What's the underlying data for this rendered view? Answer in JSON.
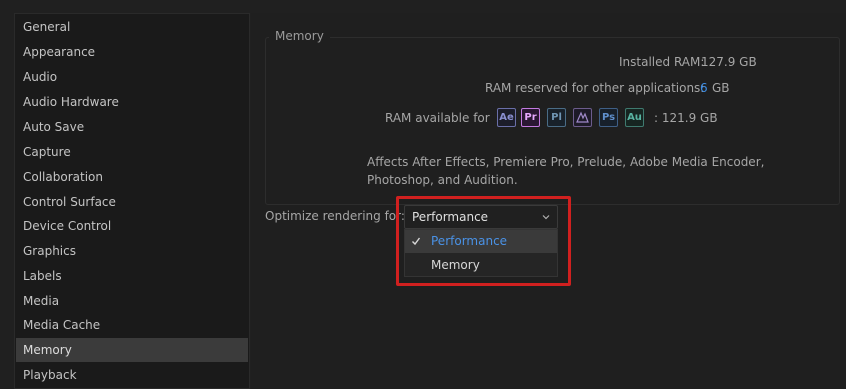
{
  "sidebar": {
    "items": [
      {
        "label": "General"
      },
      {
        "label": "Appearance"
      },
      {
        "label": "Audio"
      },
      {
        "label": "Audio Hardware"
      },
      {
        "label": "Auto Save"
      },
      {
        "label": "Capture"
      },
      {
        "label": "Collaboration"
      },
      {
        "label": "Control Surface"
      },
      {
        "label": "Device Control"
      },
      {
        "label": "Graphics"
      },
      {
        "label": "Labels"
      },
      {
        "label": "Media"
      },
      {
        "label": "Media Cache"
      },
      {
        "label": "Memory",
        "selected": true
      },
      {
        "label": "Playback"
      }
    ]
  },
  "memory": {
    "group_title": "Memory",
    "installed_ram_label": "Installed RAM:",
    "installed_ram_value": "127.9 GB",
    "reserved_label": "RAM reserved for other applications:",
    "reserved_value": "6",
    "reserved_unit": "GB",
    "available_label": "RAM available for",
    "available_value": ": 121.9 GB",
    "apps": [
      {
        "abbr": "Ae",
        "icon": "after-effects-icon"
      },
      {
        "abbr": "Pr",
        "icon": "premiere-pro-icon"
      },
      {
        "abbr": "Pl",
        "icon": "prelude-icon"
      },
      {
        "abbr": "",
        "icon": "media-encoder-icon"
      },
      {
        "abbr": "Ps",
        "icon": "photoshop-icon"
      },
      {
        "abbr": "Au",
        "icon": "audition-icon"
      }
    ],
    "note_line1": "Affects After Effects, Premiere Pro, Prelude, Adobe Media Encoder,",
    "note_line2": "Photoshop, and Audition."
  },
  "optimize": {
    "label": "Optimize rendering for:",
    "selected": "Performance",
    "options": [
      "Performance",
      "Memory"
    ]
  },
  "colors": {
    "accent_blue": "#3f8fe6",
    "highlight_red": "#d0201f"
  }
}
